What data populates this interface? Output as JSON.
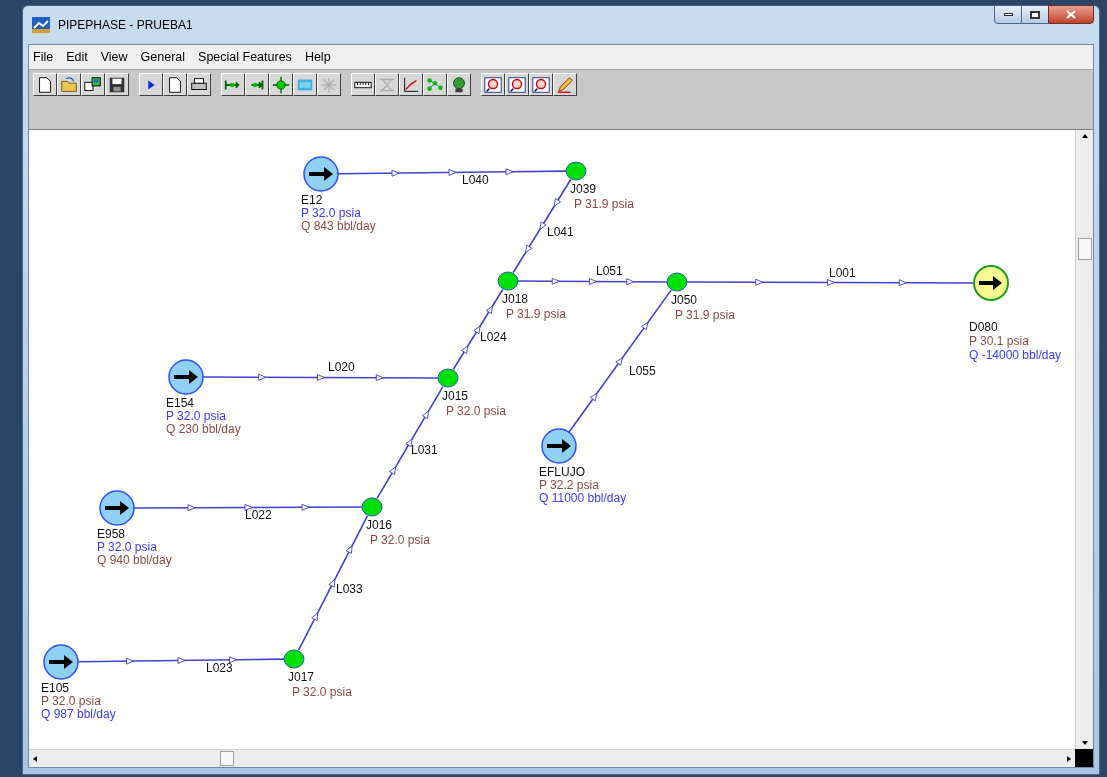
{
  "window": {
    "title": "PIPEPHASE - PRUEBA1"
  },
  "menu": [
    "File",
    "Edit",
    "View",
    "General",
    "Special Features",
    "Help"
  ],
  "network": {
    "nodes": [
      {
        "kind": "source",
        "name": "E12",
        "readings": [
          {
            "text": "P 32.0 psia",
            "color": "#3a3aff"
          },
          {
            "text": "Q 843 bbl/day",
            "color": "#8b4a4a"
          }
        ]
      },
      {
        "kind": "junction",
        "name": "J039",
        "readings": [
          {
            "text": "P 31.9 psia",
            "color": "#8b4a4a"
          }
        ]
      },
      {
        "kind": "junction",
        "name": "J018",
        "readings": [
          {
            "text": "P 31.9 psia",
            "color": "#8b4a4a"
          }
        ]
      },
      {
        "kind": "junction",
        "name": "J050",
        "readings": [
          {
            "text": "P 31.9 psia",
            "color": "#8b4a4a"
          }
        ]
      },
      {
        "kind": "sink",
        "name": "D080",
        "readings": [
          {
            "text": "P 30.1 psia",
            "color": "#8b4a4a"
          },
          {
            "text": "Q -14000 bbl/day",
            "color": "#3a3aff"
          }
        ]
      },
      {
        "kind": "source",
        "name": "E154",
        "readings": [
          {
            "text": "P 32.0 psia",
            "color": "#3a3aff"
          },
          {
            "text": "Q 230 bbl/day",
            "color": "#8b4a4a"
          }
        ]
      },
      {
        "kind": "junction",
        "name": "J015",
        "readings": [
          {
            "text": "P 32.0 psia",
            "color": "#8b4a4a"
          }
        ]
      },
      {
        "kind": "source",
        "name": "EFLUJO",
        "readings": [
          {
            "text": "P 32.2 psia",
            "color": "#8b4a4a"
          },
          {
            "text": "Q 11000 bbl/day",
            "color": "#3a3aff"
          }
        ]
      },
      {
        "kind": "junction",
        "name": "J016",
        "readings": [
          {
            "text": "P 32.0 psia",
            "color": "#8b4a4a"
          }
        ]
      },
      {
        "kind": "source",
        "name": "E958",
        "readings": [
          {
            "text": "P 32.0 psia",
            "color": "#3a3aff"
          },
          {
            "text": "Q 940 bbl/day",
            "color": "#8b4a4a"
          }
        ]
      },
      {
        "kind": "source",
        "name": "E105",
        "readings": [
          {
            "text": "P 32.0 psia",
            "color": "#8b4a4a"
          },
          {
            "text": "Q 987 bbl/day",
            "color": "#3a3aff"
          }
        ]
      },
      {
        "kind": "junction",
        "name": "J017",
        "readings": [
          {
            "text": "P 32.0 psia",
            "color": "#8b4a4a"
          }
        ]
      }
    ],
    "pipes": [
      {
        "name": "L040"
      },
      {
        "name": "L041"
      },
      {
        "name": "L051"
      },
      {
        "name": "L001"
      },
      {
        "name": "L024"
      },
      {
        "name": "L020"
      },
      {
        "name": "L031"
      },
      {
        "name": "L055"
      },
      {
        "name": "L022"
      },
      {
        "name": "L033"
      },
      {
        "name": "L023"
      }
    ]
  }
}
